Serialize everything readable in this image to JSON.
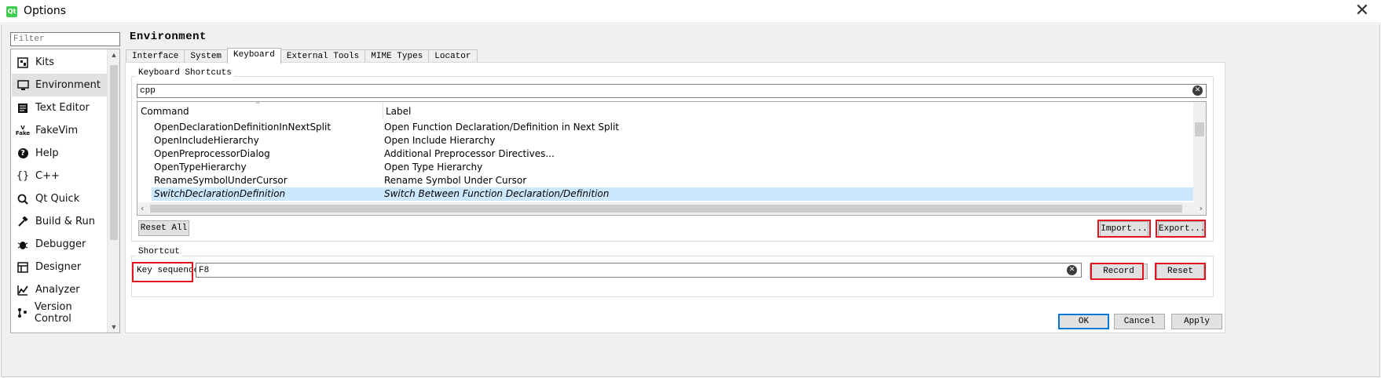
{
  "window": {
    "title": "Options",
    "app_icon_text": "Qt"
  },
  "sidebar": {
    "filter_placeholder": "Filter",
    "items": [
      {
        "label": "Kits",
        "icon": "kits-icon"
      },
      {
        "label": "Environment",
        "icon": "monitor-icon",
        "selected": true
      },
      {
        "label": "Text Editor",
        "icon": "text-editor-icon"
      },
      {
        "label": "FakeVim",
        "icon": "fakevim-icon"
      },
      {
        "label": "Help",
        "icon": "help-icon"
      },
      {
        "label": "C++",
        "icon": "braces-icon"
      },
      {
        "label": "Qt Quick",
        "icon": "qt-quick-icon"
      },
      {
        "label": "Build & Run",
        "icon": "hammer-icon"
      },
      {
        "label": "Debugger",
        "icon": "bug-icon"
      },
      {
        "label": "Designer",
        "icon": "designer-icon"
      },
      {
        "label": "Analyzer",
        "icon": "analyzer-icon"
      },
      {
        "label": "Version Control",
        "icon": "version-control-icon"
      }
    ]
  },
  "page": {
    "title": "Environment",
    "tabs": [
      "Interface",
      "System",
      "Keyboard",
      "External Tools",
      "MIME Types",
      "Locator"
    ],
    "active_tab": "Keyboard"
  },
  "shortcuts": {
    "group_title": "Keyboard Shortcuts",
    "search_value": "cpp",
    "columns": [
      "Command",
      "Label"
    ],
    "rows": [
      {
        "command": "OpenDeclarationDefinitionInNextSplit",
        "label": "Open Function Declaration/Definition in Next Split"
      },
      {
        "command": "OpenIncludeHierarchy",
        "label": "Open Include Hierarchy"
      },
      {
        "command": "OpenPreprocessorDialog",
        "label": "Additional Preprocessor Directives..."
      },
      {
        "command": "OpenTypeHierarchy",
        "label": "Open Type Hierarchy"
      },
      {
        "command": "RenameSymbolUnderCursor",
        "label": "Rename Symbol Under Cursor"
      },
      {
        "command": "SwitchDeclarationDefinition",
        "label": "Switch Between Function Declaration/Definition",
        "selected": true
      }
    ],
    "reset_all": "Reset All",
    "import": "Import...",
    "export": "Export..."
  },
  "shortcut": {
    "group_title": "Shortcut",
    "key_sequence_label": "Key sequence:",
    "key_sequence_value": "F8",
    "record": "Record",
    "reset": "Reset"
  },
  "footer": {
    "ok": "OK",
    "cancel": "Cancel",
    "apply": "Apply"
  },
  "colors": {
    "selection": "#cce8ff",
    "highlight_box": "#e0151f",
    "default_button": "#0078d7"
  }
}
